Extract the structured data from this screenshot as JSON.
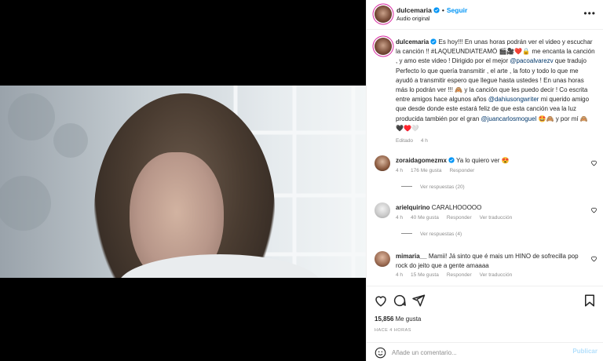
{
  "header": {
    "username": "dulcemaria",
    "separator": "•",
    "follow_label": "Seguir",
    "audio": "Audio original",
    "more_icon": "more-horizontal-icon"
  },
  "caption": {
    "username": "dulcemaria",
    "part1": "Es hoy!!! En unas horas podrán ver el video y escuchar la canción !! #LAQUEUNDIATEAMÓ 🎬🎥❤️🔒 me encanta la canción , y amo este video ! Dirigido por el mejor ",
    "mention1": "@pacoalvarezv",
    "part2": " que tradujo Perfecto lo que quería transmitir , el arte , la foto y todo lo que me ayudó a transmitir espero que llegue hasta ustedes ! En unas horas más lo podrán ver !!! 🙈 y la canción que les puedo decir ! Co escrita entre amigos hace algunos años ",
    "mention2": "@dahiusongwriter",
    "part3": " mi querido amigo que desde donde este estará feliz de que esta canción vea la luz producida también por el gran ",
    "mention3": "@juancarlosmoguel",
    "part4": " 🤩🙈 y por mí 🙈 🖤♥️🤍",
    "edited": "Editado",
    "time": "4 h"
  },
  "comments": [
    {
      "username": "zoraidagomezmx",
      "text": "Ya lo quiero ver 😍",
      "time": "4 h",
      "likes": "176 Me gusta",
      "reply": "Responder",
      "translate": "",
      "view_replies": "Ver respuestas (20)"
    },
    {
      "username": "arielquirino",
      "text": "CARALHOOOOO",
      "time": "4 h",
      "likes": "40 Me gusta",
      "reply": "Responder",
      "translate": "Ver traducción",
      "view_replies": "Ver respuestas (4)"
    },
    {
      "username": "mimaria__",
      "text": "Mamii! Já sinto que é mais um HINO de sofrecilla pop rock do jeito que a gente amaaaa",
      "time": "4 h",
      "likes": "15 Me gusta",
      "reply": "Responder",
      "translate": "Ver traducción",
      "view_replies": ""
    }
  ],
  "actions": {
    "likes_count": "15,856",
    "likes_label": "Me gusta",
    "posted_ago": "Hace 4 horas"
  },
  "add_comment": {
    "placeholder": "Añade un comentario...",
    "post_label": "Publicar"
  },
  "colors": {
    "accent": "#0095f6",
    "link": "#00376b",
    "muted": "#8e8e8e",
    "like": "#ed4956"
  }
}
